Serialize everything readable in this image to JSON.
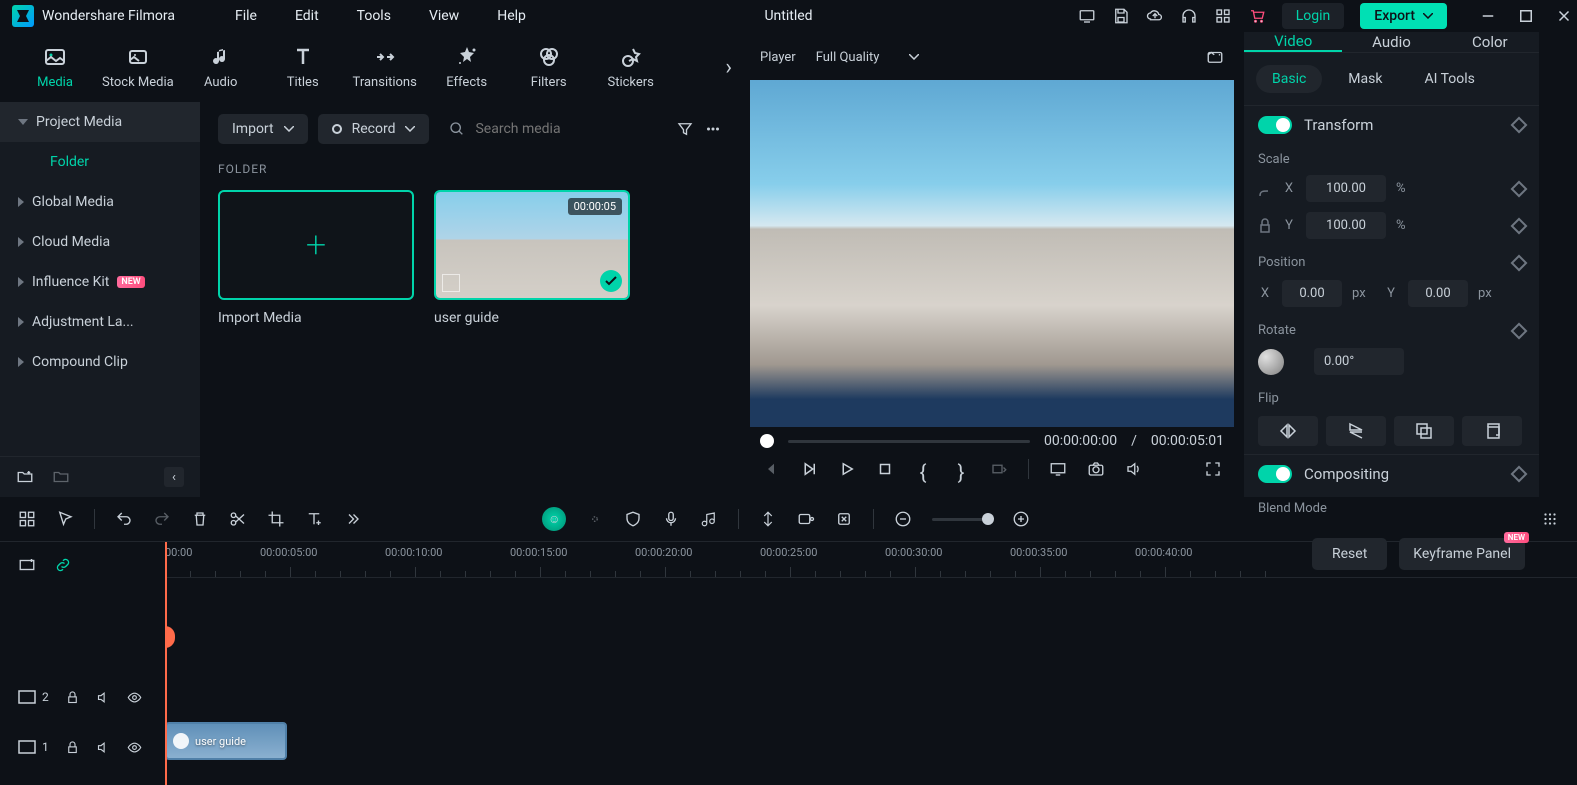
{
  "app": {
    "name": "Wondershare Filmora",
    "title": "Untitled"
  },
  "menu": [
    "File",
    "Edit",
    "Tools",
    "View",
    "Help"
  ],
  "titlebar": {
    "login": "Login",
    "export": "Export"
  },
  "tabs": [
    {
      "label": "Media",
      "icon": "media"
    },
    {
      "label": "Stock Media",
      "icon": "stock"
    },
    {
      "label": "Audio",
      "icon": "audio"
    },
    {
      "label": "Titles",
      "icon": "titles"
    },
    {
      "label": "Transitions",
      "icon": "transitions"
    },
    {
      "label": "Effects",
      "icon": "effects"
    },
    {
      "label": "Filters",
      "icon": "filters"
    },
    {
      "label": "Stickers",
      "icon": "stickers"
    }
  ],
  "sidebar": {
    "items": [
      {
        "label": "Project Media",
        "active": true
      },
      {
        "label": "Folder",
        "folder": true
      },
      {
        "label": "Global Media"
      },
      {
        "label": "Cloud Media"
      },
      {
        "label": "Influence Kit",
        "new": true
      },
      {
        "label": "Adjustment La..."
      },
      {
        "label": "Compound Clip"
      }
    ]
  },
  "toolbar": {
    "import": "Import",
    "record": "Record",
    "search_placeholder": "Search media"
  },
  "content": {
    "folder_label": "FOLDER",
    "import_label": "Import Media",
    "clip": {
      "label": "user guide",
      "duration": "00:00:05"
    }
  },
  "preview": {
    "player": "Player",
    "quality": "Full Quality",
    "current": "00:00:00:00",
    "sep": "/",
    "total": "00:00:05:01"
  },
  "props": {
    "tabs": [
      "Video",
      "Audio",
      "Color"
    ],
    "subtabs": [
      "Basic",
      "Mask",
      "AI Tools"
    ],
    "transform": "Transform",
    "scale": "Scale",
    "scale_x": "100.00",
    "scale_y": "100.00",
    "position": "Position",
    "pos_x": "0.00",
    "pos_y": "0.00",
    "rotate": "Rotate",
    "rotate_val": "0.00°",
    "flip": "Flip",
    "compositing": "Compositing",
    "blend": "Blend Mode",
    "reset": "Reset",
    "keyframe": "Keyframe Panel",
    "new_badge": "NEW",
    "x": "X",
    "y": "Y",
    "pct": "%",
    "px": "px"
  },
  "timeline": {
    "marks": [
      "00:00",
      "00:00:05:00",
      "00:00:10:00",
      "00:00:15:00",
      "00:00:20:00",
      "00:00:25:00",
      "00:00:30:00",
      "00:00:35:00",
      "00:00:40:00"
    ],
    "track2": "2",
    "track1": "1",
    "clip_label": "user guide"
  }
}
